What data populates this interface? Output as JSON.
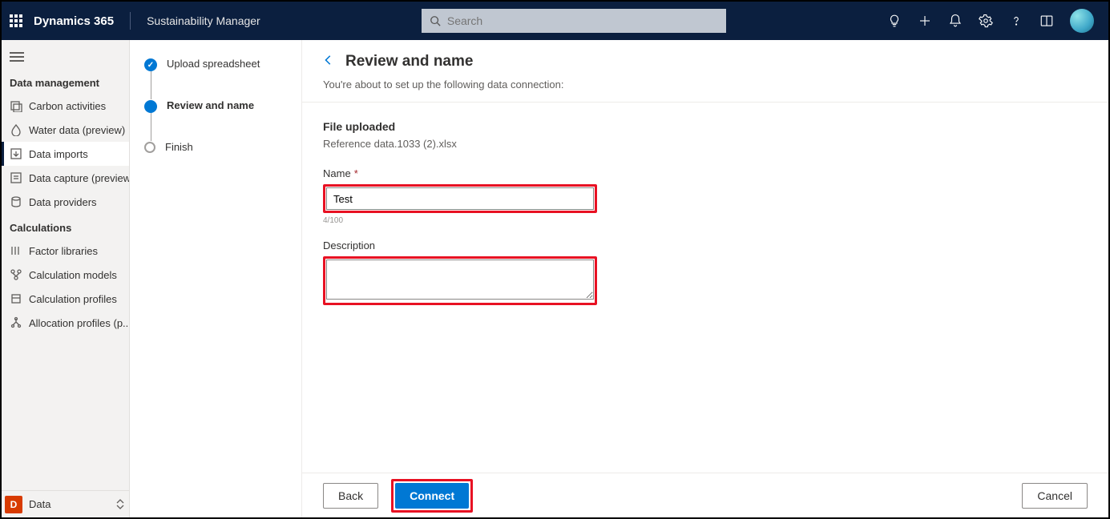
{
  "header": {
    "brand": "Dynamics 365",
    "appName": "Sustainability Manager",
    "searchPlaceholder": "Search"
  },
  "sidenav": {
    "sectionDataMgmt": "Data management",
    "items": {
      "carbon": "Carbon activities",
      "water": "Water data (preview)",
      "imports": "Data imports",
      "capture": "Data capture (preview)",
      "providers": "Data providers"
    },
    "sectionCalc": "Calculations",
    "calcItems": {
      "libraries": "Factor libraries",
      "models": "Calculation models",
      "profiles": "Calculation profiles",
      "allocation": "Allocation profiles (p..."
    },
    "footerBadge": "D",
    "footerLabel": "Data"
  },
  "steps": {
    "upload": "Upload spreadsheet",
    "review": "Review and name",
    "finish": "Finish"
  },
  "main": {
    "title": "Review and name",
    "subtitle": "You're about to set up the following data connection:",
    "fileSectionTitle": "File uploaded",
    "fileName": "Reference data.1033 (2).xlsx",
    "nameLabel": "Name",
    "nameValue": "Test",
    "nameCounter": "4/100",
    "descLabel": "Description",
    "descValue": ""
  },
  "buttons": {
    "back": "Back",
    "connect": "Connect",
    "cancel": "Cancel"
  }
}
